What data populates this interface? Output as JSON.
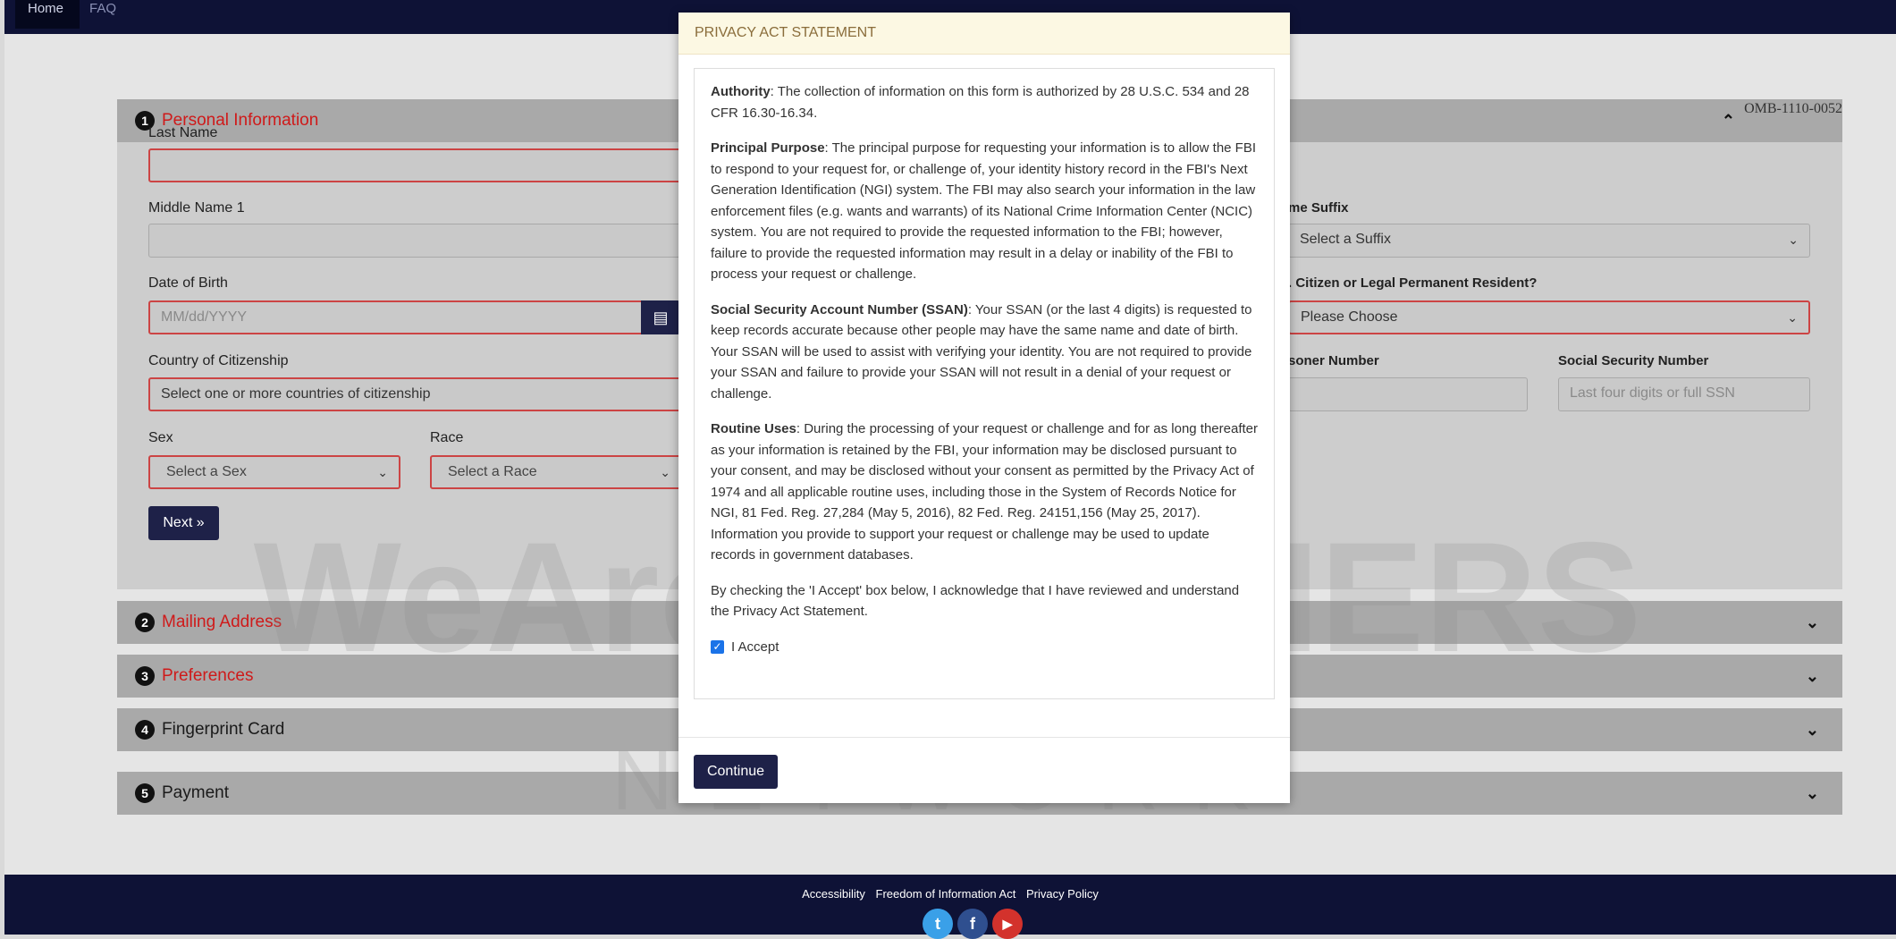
{
  "topnav": {
    "home": "Home",
    "faq": "FAQ"
  },
  "form": {
    "omb": "OMB-1110-0052",
    "panels": [
      {
        "num": "1",
        "title": "Personal Information"
      },
      {
        "num": "2",
        "title": "Mailing Address"
      },
      {
        "num": "3",
        "title": "Preferences"
      },
      {
        "num": "4",
        "title": "Fingerprint Card"
      },
      {
        "num": "5",
        "title": "Payment"
      }
    ],
    "labels": {
      "last_name": "Last Name",
      "middle_name": "Middle Name 1",
      "dob": "Date of Birth",
      "country": "Country of Citizenship",
      "sex": "Sex",
      "race": "Race",
      "suffix": "me Suffix",
      "citizen": ". Citizen or Legal Permanent Resident?",
      "prisoner": "soner Number",
      "ssn": "Social Security Number"
    },
    "placeholders": {
      "dob": "MM/dd/YYYY",
      "ssn": "Last four digits or full SSN"
    },
    "values": {
      "country": "Select one or more countries of citizenship",
      "sex": "Select a Sex",
      "race": "Select a Race",
      "suffix": "Select a Suffix",
      "citizen": "Please Choose"
    },
    "next": "Next"
  },
  "modal": {
    "title": "PRIVACY ACT STATEMENT",
    "authority_label": "Authority",
    "authority_text": ": The collection of information on this form is authorized by 28 U.S.C. 534 and 28 CFR 16.30-16.34.",
    "purpose_label": "Principal Purpose",
    "purpose_text": ": The principal purpose for requesting your information is to allow the FBI to respond to your request for, or challenge of, your identity history record in the FBI's Next Generation Identification (NGI) system. The FBI may also search your information in the law enforcement files (e.g. wants and warrants) of its National Crime Information Center (NCIC) system. You are not required to provide the requested information to the FBI; however, failure to provide the requested information may result in a delay or inability of the FBI to process your request or challenge.",
    "ssan_label": "Social Security Account Number (SSAN)",
    "ssan_text": ": Your SSAN (or the last 4 digits) is requested to keep records accurate because other people may have the same name and date of birth. Your SSAN will be used to assist with verifying your identity. You are not required to provide your SSAN and failure to provide your SSAN will not result in a denial of your request or challenge.",
    "routine_label": "Routine Uses",
    "routine_text": ": During the processing of your request or challenge and for as long thereafter as your information is retained by the FBI, your information may be disclosed pursuant to your consent, and may be disclosed without your consent as permitted by the Privacy Act of 1974 and all applicable routine uses, including those in the System of Records Notice for NGI, 81 Fed. Reg. 27,284 (May 5, 2016), 82 Fed. Reg. 24151,156 (May 25, 2017). Information you provide to support your request or challenge may be used to update records in government databases.",
    "ack_text": "By checking the 'I Accept' box below, I acknowledge that I have reviewed and understand the Privacy Act Statement.",
    "accept_label": "I Accept",
    "accept_checked": true,
    "continue": "Continue"
  },
  "watermark": {
    "line1": "WeAreDREAMERS",
    "line2": "NETWORK"
  },
  "footer": {
    "links": [
      "Accessibility",
      "Freedom of Information Act",
      "Privacy Policy"
    ],
    "social": [
      {
        "icon": "twitter-icon",
        "glyph": "t",
        "color": "#3aa0e8"
      },
      {
        "icon": "facebook-icon",
        "glyph": "f",
        "color": "#2f4f8f"
      },
      {
        "icon": "youtube-icon",
        "glyph": "▶",
        "color": "#d3322c"
      }
    ]
  }
}
